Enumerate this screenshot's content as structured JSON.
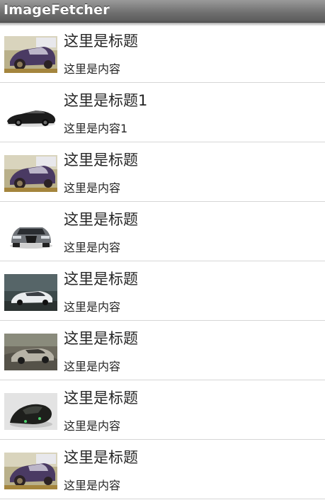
{
  "app": {
    "title": "ImageFetcher"
  },
  "list": {
    "items": [
      {
        "title": "这里是标题",
        "content": "这里是内容",
        "thumbnail": "car-photo-purple-coupe"
      },
      {
        "title": "这里是标题1",
        "content": "这里是内容1",
        "thumbnail": "car-photo-black-supercar"
      },
      {
        "title": "这里是标题",
        "content": "这里是内容",
        "thumbnail": "car-photo-purple-coupe"
      },
      {
        "title": "这里是标题",
        "content": "这里是内容",
        "thumbnail": "car-photo-gray-sedan-front"
      },
      {
        "title": "这里是标题",
        "content": "这里是内容",
        "thumbnail": "car-photo-white-supercar"
      },
      {
        "title": "这里是标题",
        "content": "这里是内容",
        "thumbnail": "car-photo-silver-roadster"
      },
      {
        "title": "这里是标题",
        "content": "这里是内容",
        "thumbnail": "car-photo-dark-concept"
      },
      {
        "title": "这里是标题",
        "content": "这里是内容",
        "thumbnail": "car-photo-purple-coupe"
      }
    ]
  },
  "colors": {
    "titlebar_top": "#9a9a9a",
    "titlebar_bottom": "#5a5a5a",
    "divider": "#d6d6d6",
    "text": "#262626",
    "background": "#ffffff"
  }
}
